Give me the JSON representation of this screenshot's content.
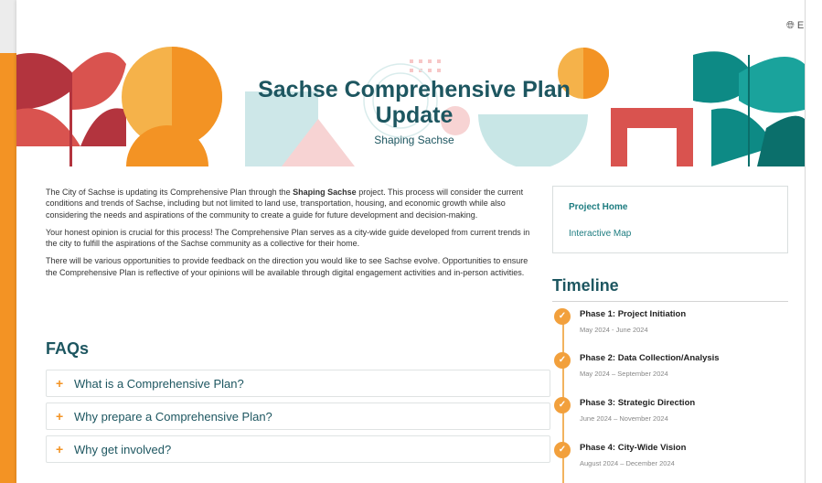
{
  "language": {
    "label": "Engl",
    "icon": "globe-icon"
  },
  "hero": {
    "title": "Sachse Comprehensive Plan Update",
    "subtitle": "Shaping Sachse"
  },
  "intro": {
    "p1_a": "The City of Sachse is updating its Comprehensive Plan through the ",
    "p1_bold": "Shaping Sachse",
    "p1_b": " project. This process will consider the current conditions and trends of Sachse, including but not limited to land use, transportation, housing, and economic growth while also considering the needs and aspirations of the community to create a guide for future development and decision-making.",
    "p2": "Your honest opinion is crucial for this process! The Comprehensive Plan serves as a city-wide guide developed from current trends in the city to fulfill the aspirations of the Sachse community as a collective for their home.",
    "p3": "There will be various opportunities to provide feedback on the direction you would like to see Sachse evolve. Opportunities to ensure the Comprehensive Plan is reflective of your opinions will be available through digital engagement activities and in-person activities."
  },
  "faqs": {
    "title": "FAQs",
    "items": [
      {
        "question": "What is a Comprehensive Plan?"
      },
      {
        "question": "Why prepare a Comprehensive Plan?"
      },
      {
        "question": "Why get involved?"
      }
    ]
  },
  "links": {
    "project_home": "Project Home",
    "interactive_map": "Interactive Map"
  },
  "timeline": {
    "title": "Timeline",
    "phases": [
      {
        "name": "Phase 1: Project Initiation",
        "dates": "May 2024 - June 2024"
      },
      {
        "name": "Phase 2: Data Collection/Analysis",
        "dates": "May 2024 – September 2024"
      },
      {
        "name": "Phase 3: Strategic Direction",
        "dates": "June 2024 – November 2024"
      },
      {
        "name": "Phase 4: City-Wide Vision",
        "dates": "August 2024 – December 2024"
      }
    ]
  },
  "colors": {
    "accent_orange": "#f39324",
    "heading_teal": "#1d5660",
    "link_teal": "#1d7c80",
    "hero_red": "#d9534f",
    "hero_teal": "#0d8a85"
  }
}
